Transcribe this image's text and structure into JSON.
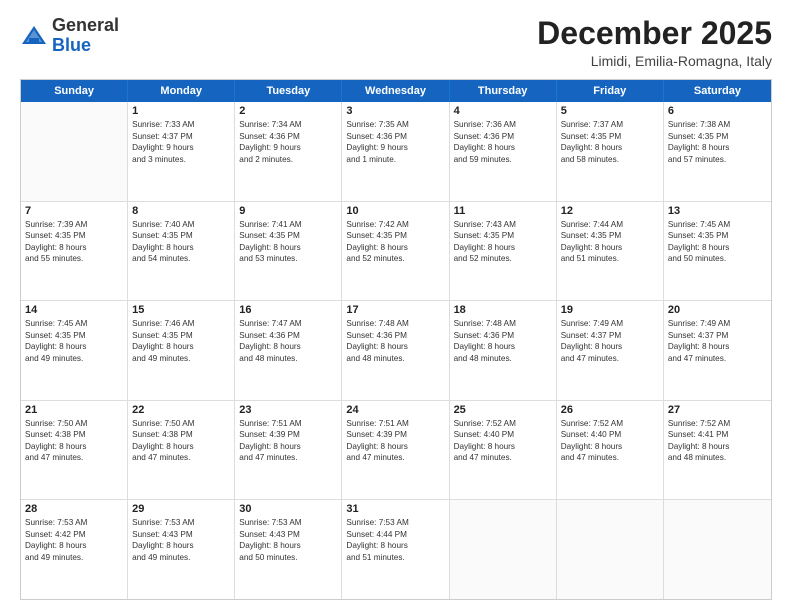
{
  "header": {
    "logo": {
      "general": "General",
      "blue": "Blue"
    },
    "title": "December 2025",
    "location": "Limidi, Emilia-Romagna, Italy"
  },
  "calendar": {
    "weekdays": [
      "Sunday",
      "Monday",
      "Tuesday",
      "Wednesday",
      "Thursday",
      "Friday",
      "Saturday"
    ],
    "rows": [
      [
        {
          "day": "",
          "lines": []
        },
        {
          "day": "1",
          "lines": [
            "Sunrise: 7:33 AM",
            "Sunset: 4:37 PM",
            "Daylight: 9 hours",
            "and 3 minutes."
          ]
        },
        {
          "day": "2",
          "lines": [
            "Sunrise: 7:34 AM",
            "Sunset: 4:36 PM",
            "Daylight: 9 hours",
            "and 2 minutes."
          ]
        },
        {
          "day": "3",
          "lines": [
            "Sunrise: 7:35 AM",
            "Sunset: 4:36 PM",
            "Daylight: 9 hours",
            "and 1 minute."
          ]
        },
        {
          "day": "4",
          "lines": [
            "Sunrise: 7:36 AM",
            "Sunset: 4:36 PM",
            "Daylight: 8 hours",
            "and 59 minutes."
          ]
        },
        {
          "day": "5",
          "lines": [
            "Sunrise: 7:37 AM",
            "Sunset: 4:35 PM",
            "Daylight: 8 hours",
            "and 58 minutes."
          ]
        },
        {
          "day": "6",
          "lines": [
            "Sunrise: 7:38 AM",
            "Sunset: 4:35 PM",
            "Daylight: 8 hours",
            "and 57 minutes."
          ]
        }
      ],
      [
        {
          "day": "7",
          "lines": [
            "Sunrise: 7:39 AM",
            "Sunset: 4:35 PM",
            "Daylight: 8 hours",
            "and 55 minutes."
          ]
        },
        {
          "day": "8",
          "lines": [
            "Sunrise: 7:40 AM",
            "Sunset: 4:35 PM",
            "Daylight: 8 hours",
            "and 54 minutes."
          ]
        },
        {
          "day": "9",
          "lines": [
            "Sunrise: 7:41 AM",
            "Sunset: 4:35 PM",
            "Daylight: 8 hours",
            "and 53 minutes."
          ]
        },
        {
          "day": "10",
          "lines": [
            "Sunrise: 7:42 AM",
            "Sunset: 4:35 PM",
            "Daylight: 8 hours",
            "and 52 minutes."
          ]
        },
        {
          "day": "11",
          "lines": [
            "Sunrise: 7:43 AM",
            "Sunset: 4:35 PM",
            "Daylight: 8 hours",
            "and 52 minutes."
          ]
        },
        {
          "day": "12",
          "lines": [
            "Sunrise: 7:44 AM",
            "Sunset: 4:35 PM",
            "Daylight: 8 hours",
            "and 51 minutes."
          ]
        },
        {
          "day": "13",
          "lines": [
            "Sunrise: 7:45 AM",
            "Sunset: 4:35 PM",
            "Daylight: 8 hours",
            "and 50 minutes."
          ]
        }
      ],
      [
        {
          "day": "14",
          "lines": [
            "Sunrise: 7:45 AM",
            "Sunset: 4:35 PM",
            "Daylight: 8 hours",
            "and 49 minutes."
          ]
        },
        {
          "day": "15",
          "lines": [
            "Sunrise: 7:46 AM",
            "Sunset: 4:35 PM",
            "Daylight: 8 hours",
            "and 49 minutes."
          ]
        },
        {
          "day": "16",
          "lines": [
            "Sunrise: 7:47 AM",
            "Sunset: 4:36 PM",
            "Daylight: 8 hours",
            "and 48 minutes."
          ]
        },
        {
          "day": "17",
          "lines": [
            "Sunrise: 7:48 AM",
            "Sunset: 4:36 PM",
            "Daylight: 8 hours",
            "and 48 minutes."
          ]
        },
        {
          "day": "18",
          "lines": [
            "Sunrise: 7:48 AM",
            "Sunset: 4:36 PM",
            "Daylight: 8 hours",
            "and 48 minutes."
          ]
        },
        {
          "day": "19",
          "lines": [
            "Sunrise: 7:49 AM",
            "Sunset: 4:37 PM",
            "Daylight: 8 hours",
            "and 47 minutes."
          ]
        },
        {
          "day": "20",
          "lines": [
            "Sunrise: 7:49 AM",
            "Sunset: 4:37 PM",
            "Daylight: 8 hours",
            "and 47 minutes."
          ]
        }
      ],
      [
        {
          "day": "21",
          "lines": [
            "Sunrise: 7:50 AM",
            "Sunset: 4:38 PM",
            "Daylight: 8 hours",
            "and 47 minutes."
          ]
        },
        {
          "day": "22",
          "lines": [
            "Sunrise: 7:50 AM",
            "Sunset: 4:38 PM",
            "Daylight: 8 hours",
            "and 47 minutes."
          ]
        },
        {
          "day": "23",
          "lines": [
            "Sunrise: 7:51 AM",
            "Sunset: 4:39 PM",
            "Daylight: 8 hours",
            "and 47 minutes."
          ]
        },
        {
          "day": "24",
          "lines": [
            "Sunrise: 7:51 AM",
            "Sunset: 4:39 PM",
            "Daylight: 8 hours",
            "and 47 minutes."
          ]
        },
        {
          "day": "25",
          "lines": [
            "Sunrise: 7:52 AM",
            "Sunset: 4:40 PM",
            "Daylight: 8 hours",
            "and 47 minutes."
          ]
        },
        {
          "day": "26",
          "lines": [
            "Sunrise: 7:52 AM",
            "Sunset: 4:40 PM",
            "Daylight: 8 hours",
            "and 47 minutes."
          ]
        },
        {
          "day": "27",
          "lines": [
            "Sunrise: 7:52 AM",
            "Sunset: 4:41 PM",
            "Daylight: 8 hours",
            "and 48 minutes."
          ]
        }
      ],
      [
        {
          "day": "28",
          "lines": [
            "Sunrise: 7:53 AM",
            "Sunset: 4:42 PM",
            "Daylight: 8 hours",
            "and 49 minutes."
          ]
        },
        {
          "day": "29",
          "lines": [
            "Sunrise: 7:53 AM",
            "Sunset: 4:43 PM",
            "Daylight: 8 hours",
            "and 49 minutes."
          ]
        },
        {
          "day": "30",
          "lines": [
            "Sunrise: 7:53 AM",
            "Sunset: 4:43 PM",
            "Daylight: 8 hours",
            "and 50 minutes."
          ]
        },
        {
          "day": "31",
          "lines": [
            "Sunrise: 7:53 AM",
            "Sunset: 4:44 PM",
            "Daylight: 8 hours",
            "and 51 minutes."
          ]
        },
        {
          "day": "",
          "lines": []
        },
        {
          "day": "",
          "lines": []
        },
        {
          "day": "",
          "lines": []
        }
      ]
    ]
  }
}
